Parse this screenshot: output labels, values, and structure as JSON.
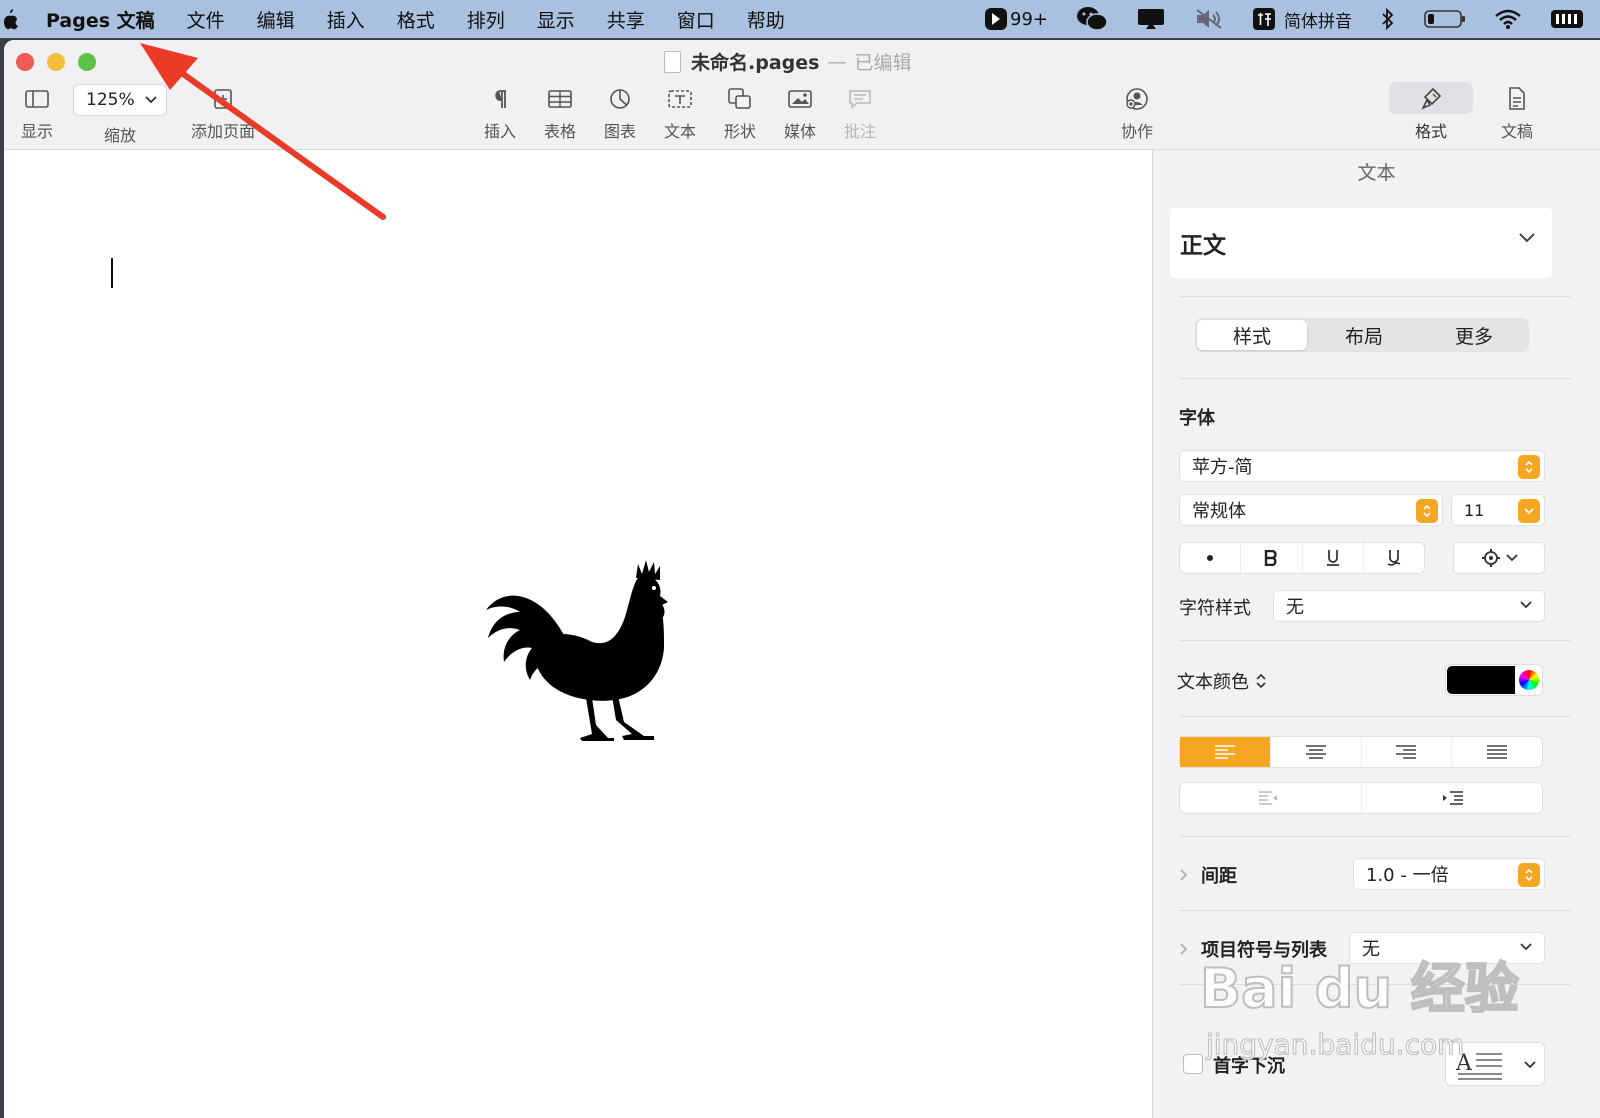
{
  "menubar": {
    "app_name": "Pages 文稿",
    "items": [
      "文件",
      "编辑",
      "插入",
      "格式",
      "排列",
      "显示",
      "共享",
      "窗口",
      "帮助"
    ],
    "status": {
      "badge_count": "99+",
      "input_method": "简体拼音"
    }
  },
  "window": {
    "doc_name": "未命名.pages",
    "separator": "—",
    "edited_label": "已编辑"
  },
  "toolbar": {
    "view_label": "显示",
    "zoom_value": "125%",
    "zoom_label": "缩放",
    "add_page_label": "添加页面",
    "insert_label": "插入",
    "table_label": "表格",
    "chart_label": "图表",
    "text_label": "文本",
    "shape_label": "形状",
    "media_label": "媒体",
    "comment_label": "批注",
    "collaborate_label": "协作",
    "format_label": "格式",
    "document_label": "文稿"
  },
  "sidebar": {
    "title": "文本",
    "paragraph_style": "正文",
    "tabs": [
      "样式",
      "布局",
      "更多"
    ],
    "font_section": "字体",
    "font_family": "苹方-简",
    "font_weight": "常规体",
    "font_size": "11",
    "char_style_label": "字符样式",
    "char_style_value": "无",
    "text_color_label": "文本颜色",
    "text_color": "#000000",
    "spacing_label": "间距",
    "spacing_value": "1.0 - 一倍",
    "bullets_label": "项目符号与列表",
    "bullets_value": "无",
    "dropcap_label": "首字下沉"
  },
  "watermark": {
    "main": "Bai du 经验",
    "sub": "jingyan.baidu.com"
  },
  "colors": {
    "accent": "#f5a623",
    "arrow": "#ea3a28",
    "menubar": "#a9c0de"
  }
}
